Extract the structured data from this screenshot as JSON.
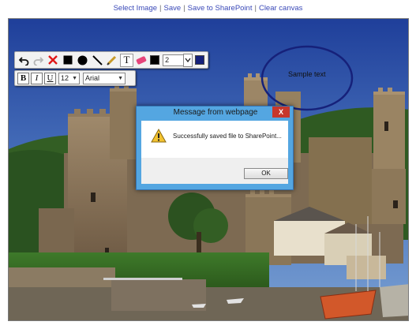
{
  "topbar": {
    "select_image": "Select Image",
    "save": "Save",
    "save_to_sharepoint": "Save to SharePoint",
    "clear_canvas": "Clear canvas",
    "separator": "|"
  },
  "toolbar": {
    "line_width": "2",
    "font_size": "12",
    "font_family": "Arial",
    "bold_label": "B",
    "italic_label": "I",
    "underline_label": "U",
    "text_tool_label": "T",
    "colors": {
      "fill": "#000000",
      "stroke": "#000000",
      "accent": "#16217a"
    }
  },
  "canvas": {
    "annotation_text": "Sample text",
    "ellipse_color": "#16217a"
  },
  "dialog": {
    "title": "Message from webpage",
    "close_label": "X",
    "message": "Successfully saved file to SharePoint...",
    "ok_label": "OK",
    "icon": "warning-icon"
  }
}
